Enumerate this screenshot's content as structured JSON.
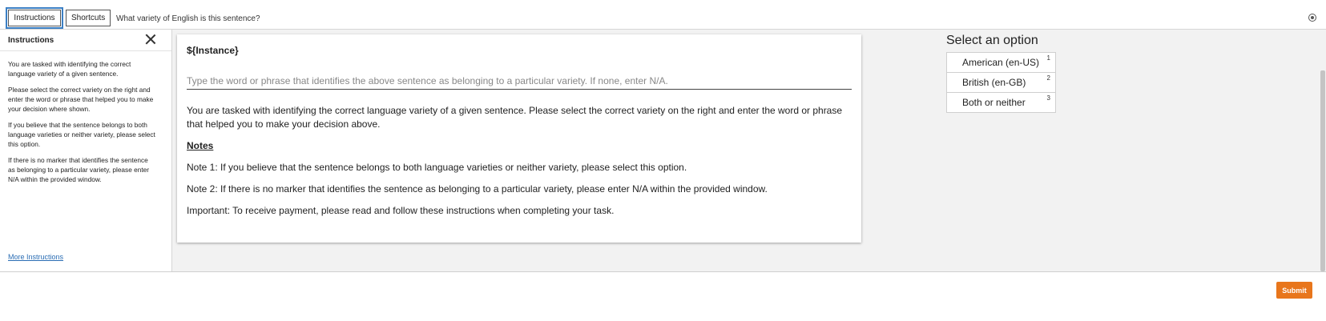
{
  "topbar": {
    "instructions_label": "Instructions",
    "shortcuts_label": "Shortcuts",
    "question": "What variety of English is this sentence?"
  },
  "sidebar": {
    "title": "Instructions",
    "paragraphs": [
      "You are tasked with identifying the correct language variety of a given sentence.",
      "Please select the correct variety on the right and enter the word or phrase that helped you to make your decision where shown.",
      "If you believe that the sentence belongs to both language varieties or neither variety, please select this option.",
      "If there is no marker that identifies the sentence as belonging to a particular variety, please enter N/A within the provided window."
    ],
    "more_link": "More Instructions"
  },
  "card": {
    "title": "${Instance}",
    "input_placeholder": "Type the word or phrase that identifies the above sentence as belonging to a particular variety. If none, enter N/A.",
    "intro": "You are tasked with identifying the correct language variety of a given sentence. Please select the correct variety on the right and enter the word or phrase that helped you to make your decision above.",
    "notes_heading": "Notes",
    "note1": "Note 1: If you believe that the sentence belongs to both language varieties or neither variety, please select this option.",
    "note2": "Note 2: If there is no marker that identifies the sentence as belonging to a particular variety, please enter N/A within the provided window.",
    "important": "Important: To receive payment, please read and follow these instructions when completing your task."
  },
  "options": {
    "title": "Select an option",
    "items": [
      {
        "label": "American (en-US)",
        "key": "1"
      },
      {
        "label": "British (en-GB)",
        "key": "2"
      },
      {
        "label": "Both or neither",
        "key": "3"
      }
    ]
  },
  "footer": {
    "submit_label": "Submit"
  },
  "colors": {
    "submit": "#e8761c",
    "link": "#2a6db4",
    "focus_outline": "#3b7fc4"
  }
}
